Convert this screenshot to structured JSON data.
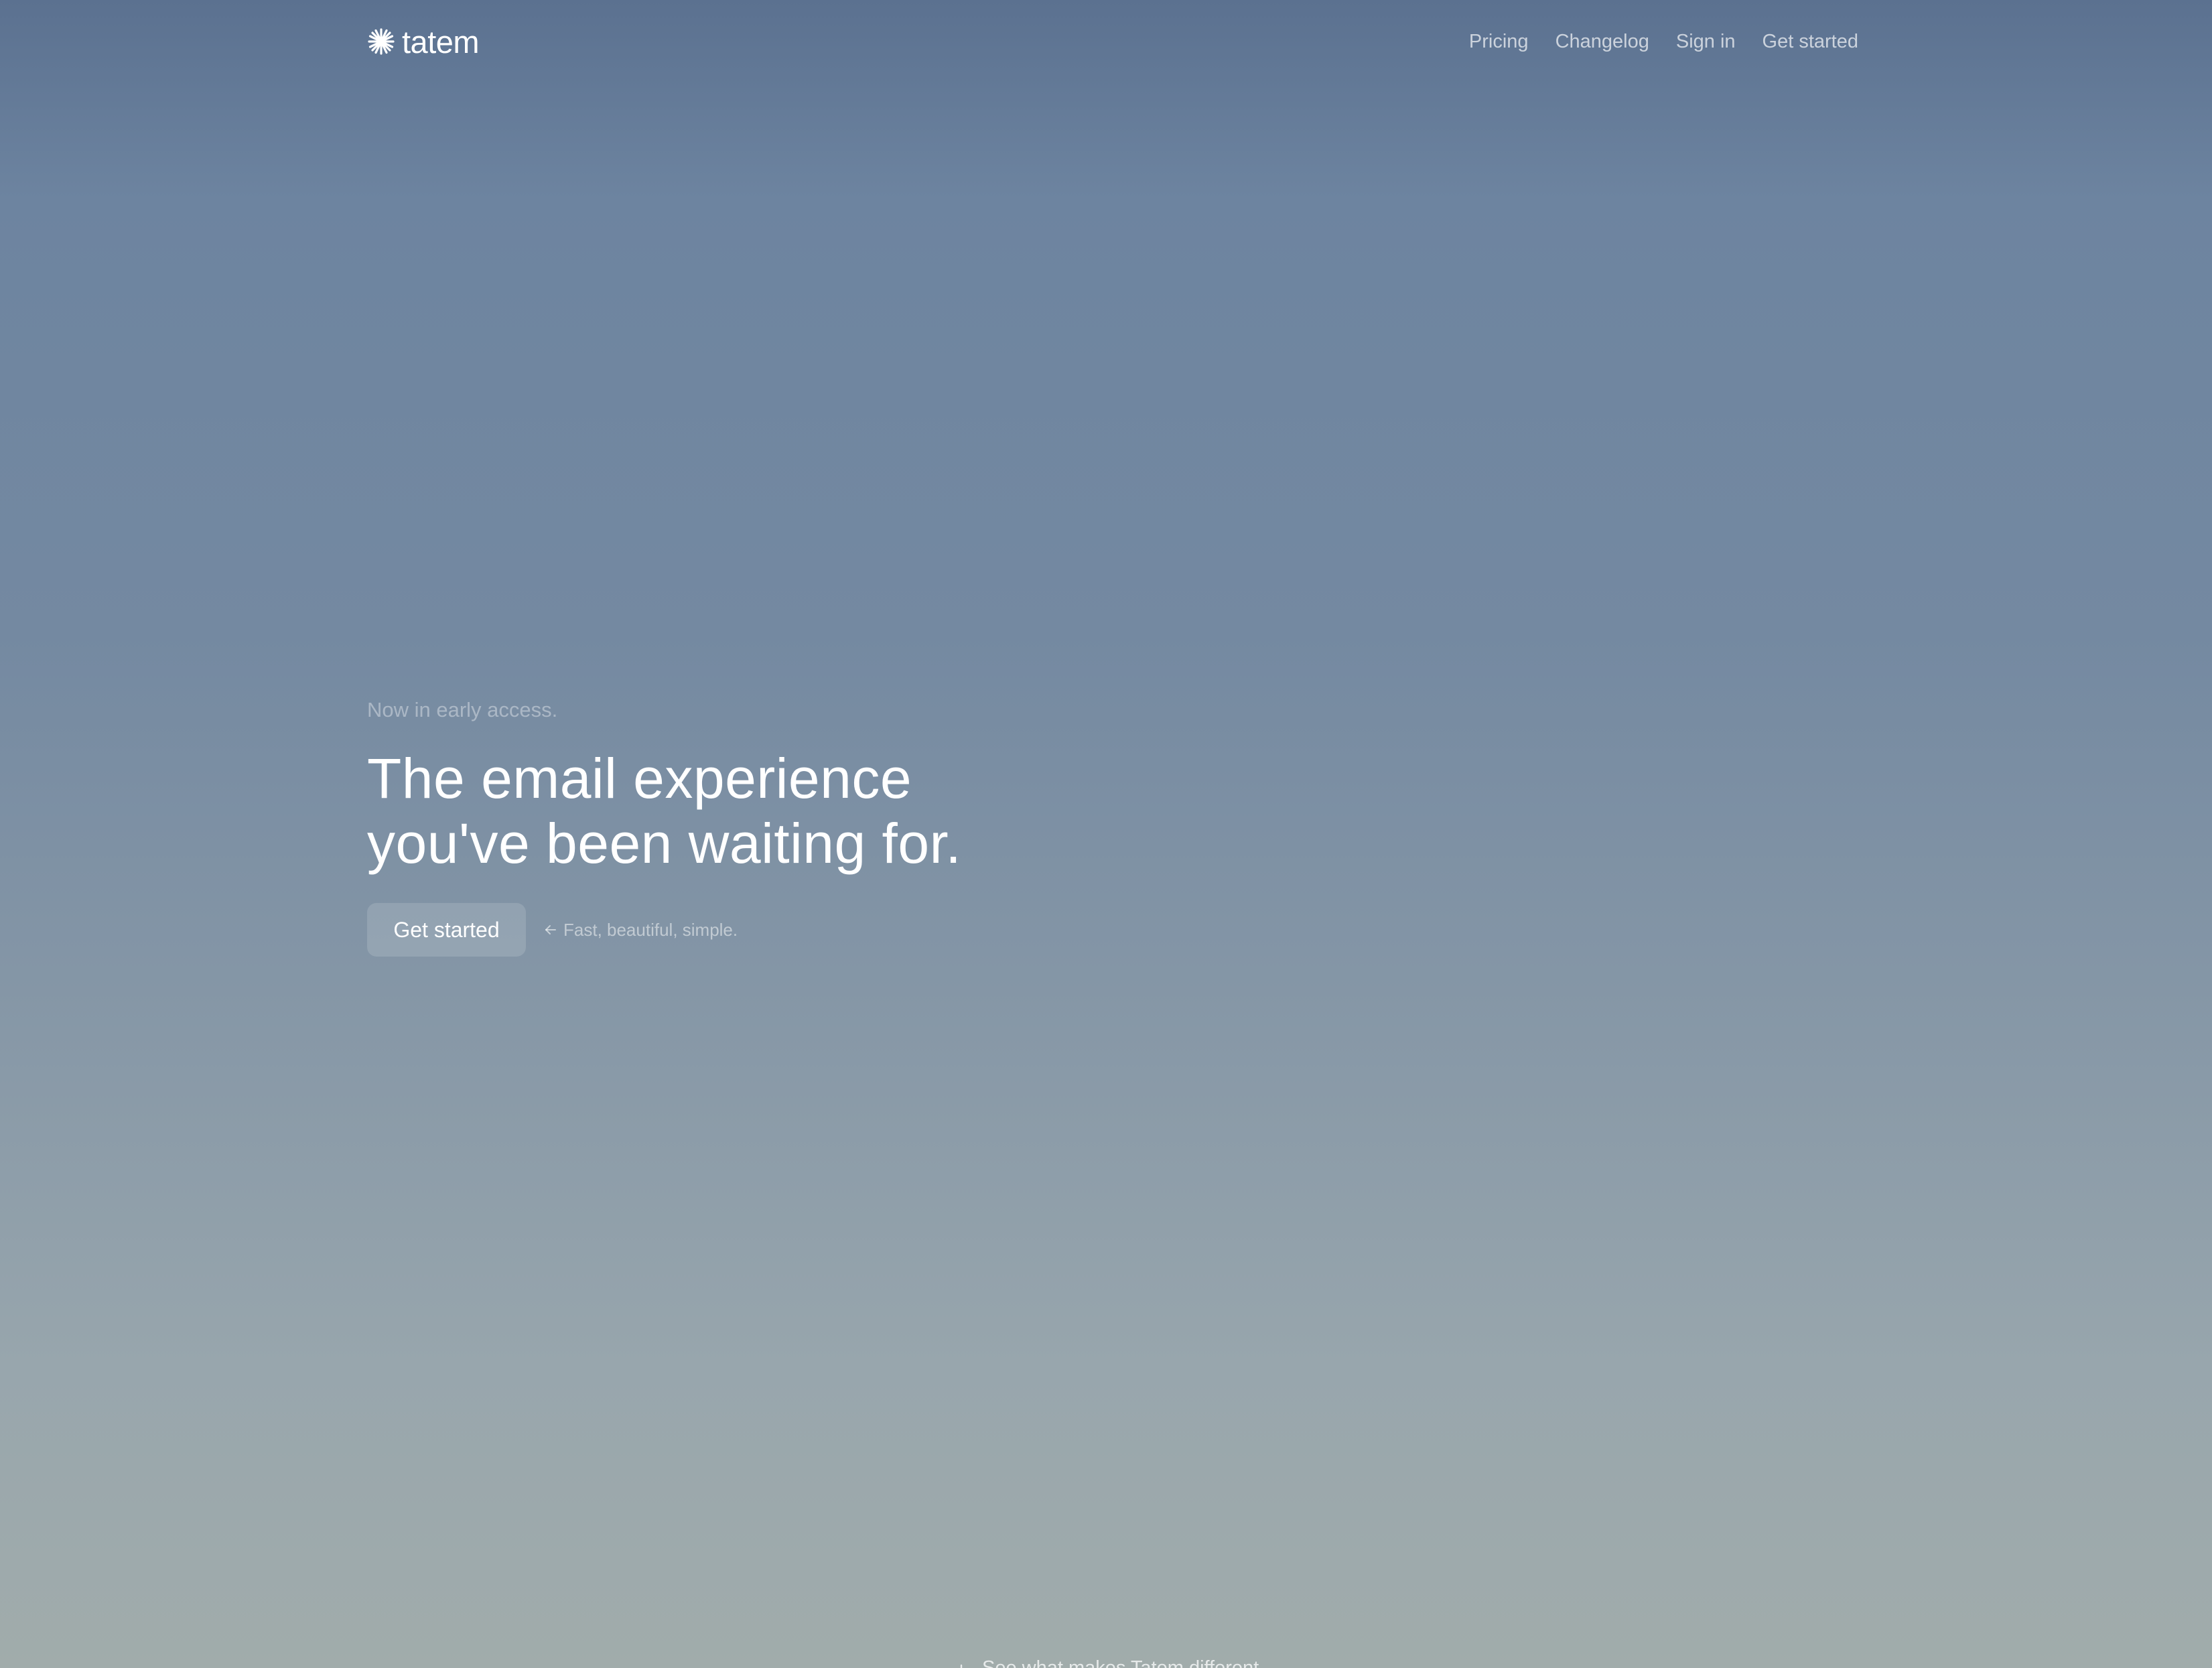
{
  "brand": {
    "name": "tatem",
    "icon": "asterisk-burst-icon"
  },
  "nav": {
    "links": [
      "Pricing",
      "Changelog",
      "Sign in",
      "Get started"
    ]
  },
  "hero": {
    "eyebrow": "Now in early access.",
    "headline_line1": "The email experience",
    "headline_line2": "you've been waiting for.",
    "cta_label": "Get started",
    "cta_note": "Fast, beautiful, simple.",
    "cta_note_icon": "arrow-left-icon"
  },
  "footer_teaser": {
    "text": "See what makes Tatem different",
    "icon": "arrow-down-icon"
  },
  "colors": {
    "background_top": "#5b7190",
    "background_bottom": "#a1acab",
    "text": "#ffffff"
  }
}
